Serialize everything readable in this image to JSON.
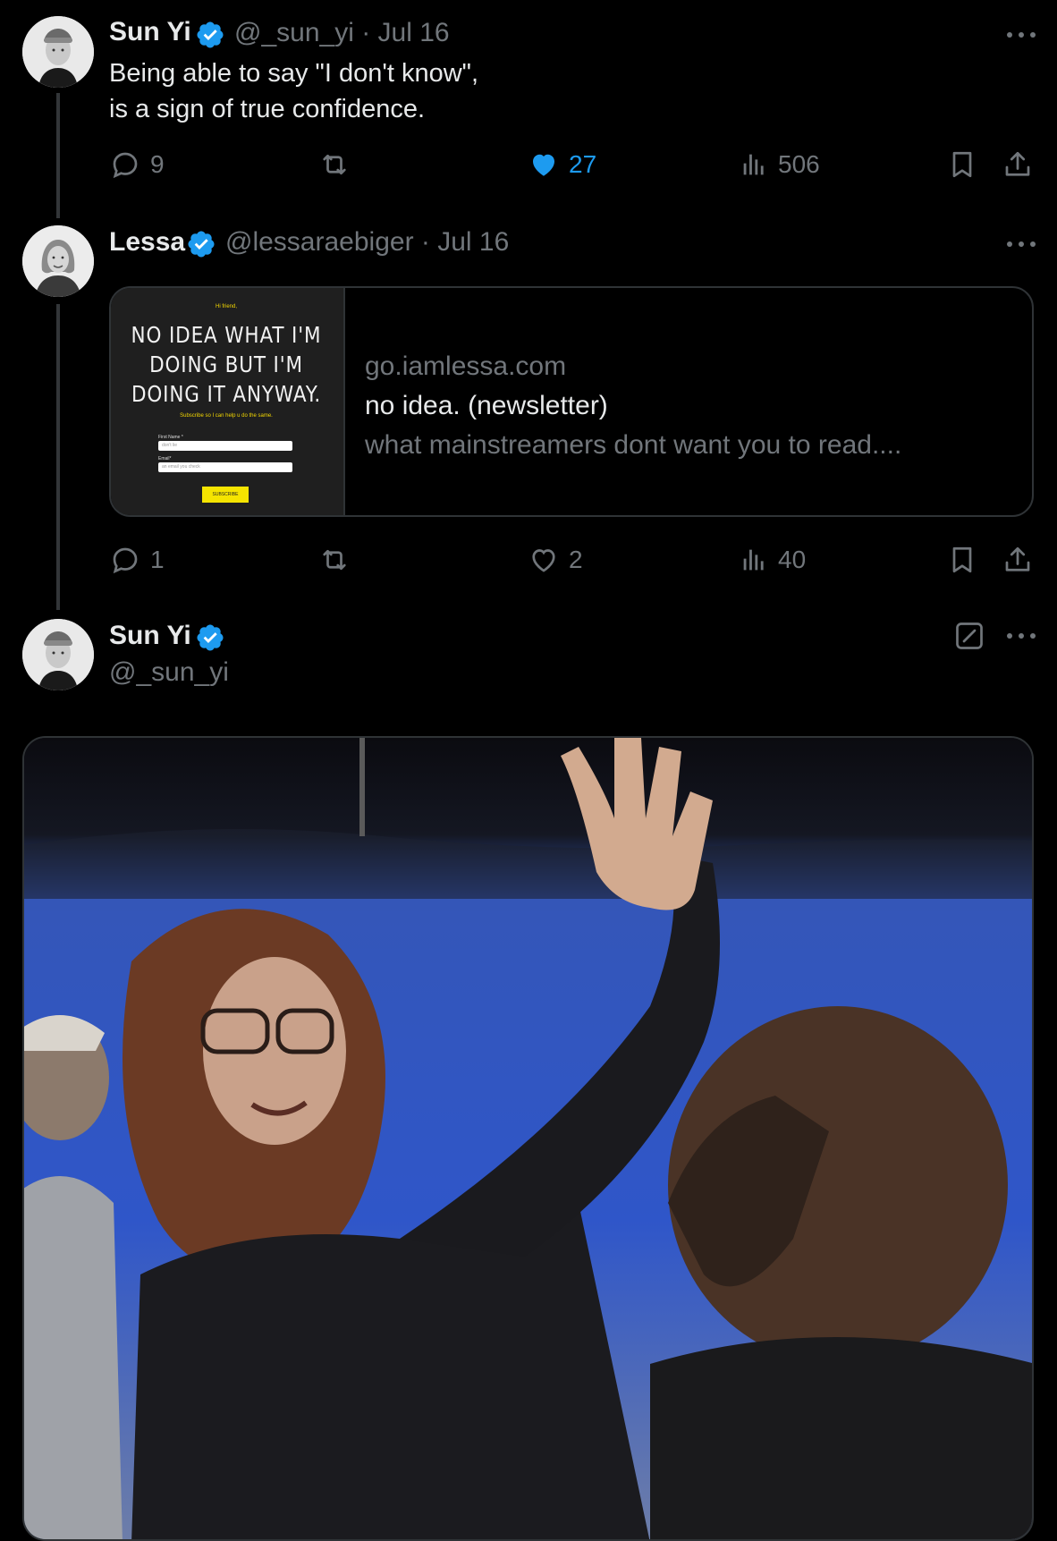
{
  "tweets": [
    {
      "name": "Sun Yi",
      "handle": "@_sun_yi",
      "separator": "·",
      "date": "Jul 16",
      "text_line1": "Being able to say \"I don't know\",",
      "text_line2": "is a sign of true confidence.",
      "replies": "9",
      "likes": "27",
      "views": "506",
      "liked": true
    },
    {
      "name": "Lessa",
      "handle": "@lessaraebiger",
      "separator": "·",
      "date": "Jul 16",
      "card": {
        "domain": "go.iamlessa.com",
        "title": "no idea. (newsletter)",
        "description": "what mainstreamers dont want you to read....",
        "thumbnail": {
          "greeting": "Hi friend,",
          "headline_line1": "NO IDEA WHAT I'M",
          "headline_line2": "DOING BUT I'M",
          "headline_line3": "DOING IT ANYWAY.",
          "subtext": "Subscribe so I can help u do the same.",
          "first_name_label": "First Name *",
          "first_name_value": "don't lie",
          "email_label": "Email*",
          "email_value": "an email you check",
          "button_label": "SUBSCRIBE"
        }
      },
      "replies": "1",
      "likes": "2",
      "views": "40",
      "liked": false
    },
    {
      "name": "Sun Yi",
      "handle": "@_sun_yi"
    }
  ],
  "colors": {
    "verified": "#1d9bf0",
    "like_active": "#1d9bf0",
    "muted": "#71767b",
    "text": "#e7e9ea",
    "border": "#2f3336"
  },
  "icons": {
    "reply": "speech-bubble-icon",
    "retweet": "retweet-icon",
    "like": "heart-icon",
    "views": "bar-chart-icon",
    "bookmark": "bookmark-icon",
    "share": "share-icon",
    "more": "more-dots-icon",
    "edit": "edit-icon",
    "verified": "verified-badge-icon"
  }
}
